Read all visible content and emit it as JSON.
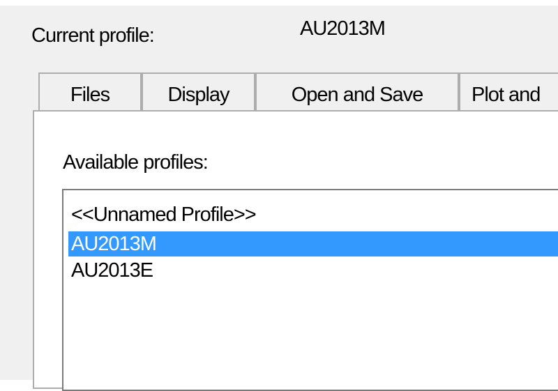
{
  "header": {
    "current_profile_label": "Current profile:",
    "current_profile_value": "AU2013M"
  },
  "tabs": [
    {
      "label": "Files",
      "active": false
    },
    {
      "label": "Display",
      "active": false
    },
    {
      "label": "Open and Save",
      "active": false
    },
    {
      "label": "Plot and",
      "active": false
    }
  ],
  "profiles": {
    "label": "Available profiles:",
    "items": [
      {
        "label": "<<Unnamed Profile>>",
        "selected": false
      },
      {
        "label": "AU2013M",
        "selected": true
      },
      {
        "label": "AU2013E",
        "selected": false
      }
    ]
  },
  "colors": {
    "dialog_background": "#f0f0f0",
    "selection_background": "#3399ff",
    "selection_text": "#ffffff",
    "border": "#adadad"
  }
}
